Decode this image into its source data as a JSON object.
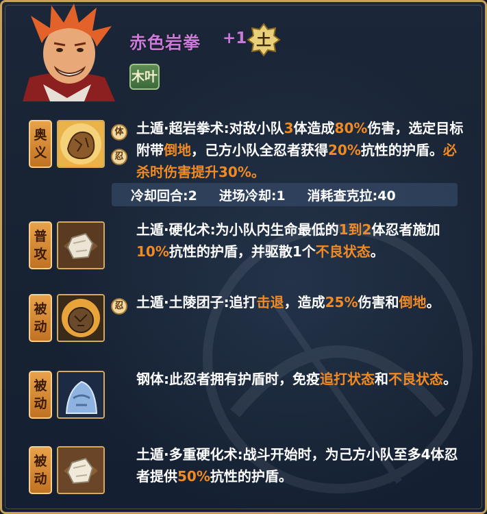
{
  "hero": {
    "name": "赤色岩拳",
    "level": "+1",
    "element_glyph": "土",
    "element_icon": "earth-element-icon",
    "tag": "木叶"
  },
  "skills": [
    {
      "type_line1": "奥",
      "type_line2": "义",
      "icon": "rock-fist-icon",
      "badges": [
        "体",
        "忍"
      ],
      "desc": [
        {
          "t": "土遁·超岩拳术:对敌小队",
          "h": false
        },
        {
          "t": "3",
          "h": true
        },
        {
          "t": "体造成",
          "h": false
        },
        {
          "t": "80%",
          "h": true
        },
        {
          "t": "伤害，选定目标附带",
          "h": false
        },
        {
          "t": "倒地",
          "h": true
        },
        {
          "t": "，己方小队全忍者获得",
          "h": false
        },
        {
          "t": "20%",
          "h": true
        },
        {
          "t": "抗性的护盾。",
          "h": false
        },
        {
          "t": "必杀时伤害提升30%。",
          "h": true
        }
      ]
    },
    {
      "type_line1": "普",
      "type_line2": "攻",
      "icon": "stone-block-icon",
      "badges": [],
      "desc": [
        {
          "t": "土遁·硬化术:为小队内生命最低的",
          "h": false
        },
        {
          "t": "1到2",
          "h": true
        },
        {
          "t": "体忍者施加",
          "h": false
        },
        {
          "t": "10%",
          "h": true
        },
        {
          "t": "抗性的护盾，并驱散1个",
          "h": false
        },
        {
          "t": "不良状态",
          "h": true
        },
        {
          "t": "。",
          "h": false
        }
      ]
    },
    {
      "type_line1": "被",
      "type_line2": "动",
      "icon": "rock-burst-icon",
      "badges": [
        "忍"
      ],
      "desc": [
        {
          "t": "土遁·土陵团子:追打",
          "h": false
        },
        {
          "t": "击退",
          "h": true
        },
        {
          "t": "，造成",
          "h": false
        },
        {
          "t": "25%",
          "h": true
        },
        {
          "t": "伤害和",
          "h": false
        },
        {
          "t": "倒地",
          "h": true
        },
        {
          "t": "。",
          "h": false
        }
      ]
    },
    {
      "type_line1": "被",
      "type_line2": "动",
      "icon": "steel-body-icon",
      "badges": [],
      "desc": [
        {
          "t": "钢体:此忍者拥有护盾时，免疫",
          "h": false
        },
        {
          "t": "追打状态",
          "h": true
        },
        {
          "t": "和",
          "h": false
        },
        {
          "t": "不良状态",
          "h": true
        },
        {
          "t": "。",
          "h": false
        }
      ]
    },
    {
      "type_line1": "被",
      "type_line2": "动",
      "icon": "stone-block-icon",
      "badges": [],
      "desc": [
        {
          "t": "土遁·多重硬化术:战斗开始时，为己方小队至多4体忍者提供",
          "h": false
        },
        {
          "t": "50%",
          "h": true
        },
        {
          "t": "抗性的护盾。",
          "h": false
        }
      ]
    }
  ],
  "cooldown": {
    "cooldown_rounds": "冷却回合:2",
    "entry_cooldown": "进场冷却:1",
    "chakra_cost": "消耗查克拉:40"
  },
  "colors": {
    "highlight": "#f08a24",
    "name": "#c97ad8",
    "border_gold": "#c9a25a"
  }
}
